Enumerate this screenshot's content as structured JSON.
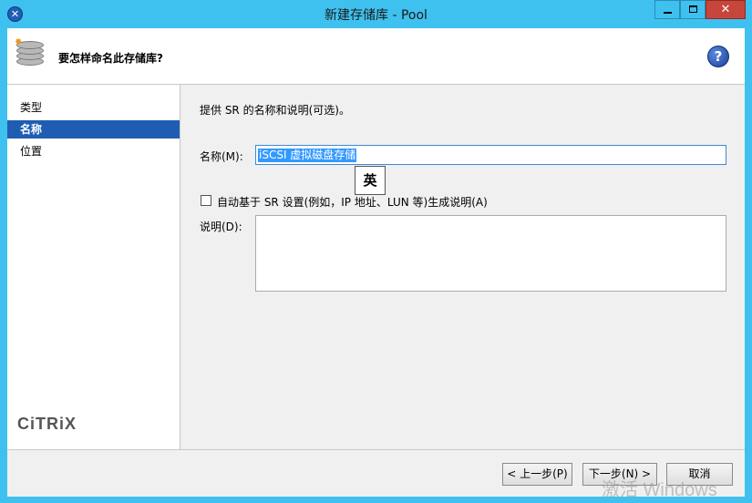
{
  "window": {
    "title": "新建存储库 - Pool",
    "minimize_label": "",
    "maximize_label": "",
    "close_label": "✕"
  },
  "header": {
    "question": "要怎样命名此存储库?",
    "help_label": "?"
  },
  "sidebar": {
    "items": [
      {
        "label": "类型",
        "active": false
      },
      {
        "label": "名称",
        "active": true
      },
      {
        "label": "位置",
        "active": false
      }
    ],
    "logo_text": "CiTRiX"
  },
  "content": {
    "instruction": "提供 SR 的名称和说明(可选)。",
    "name_label": "名称(M):",
    "name_value": "iSCSI 虚拟磁盘存储",
    "ime_label": "英",
    "auto_description_label": "自动基于 SR 设置(例如，IP 地址、LUN 等)生成说明(A)",
    "auto_description_checked": false,
    "description_label": "说明(D):",
    "description_value": ""
  },
  "footer": {
    "back_label": "< 上一步(P)",
    "next_label": "下一步(N) >",
    "cancel_label": "取消"
  },
  "watermark": "激活 Windows",
  "colors": {
    "title_bar": "#3fc1ef",
    "selected": "#1f5db3",
    "close_button": "#c7463b"
  }
}
